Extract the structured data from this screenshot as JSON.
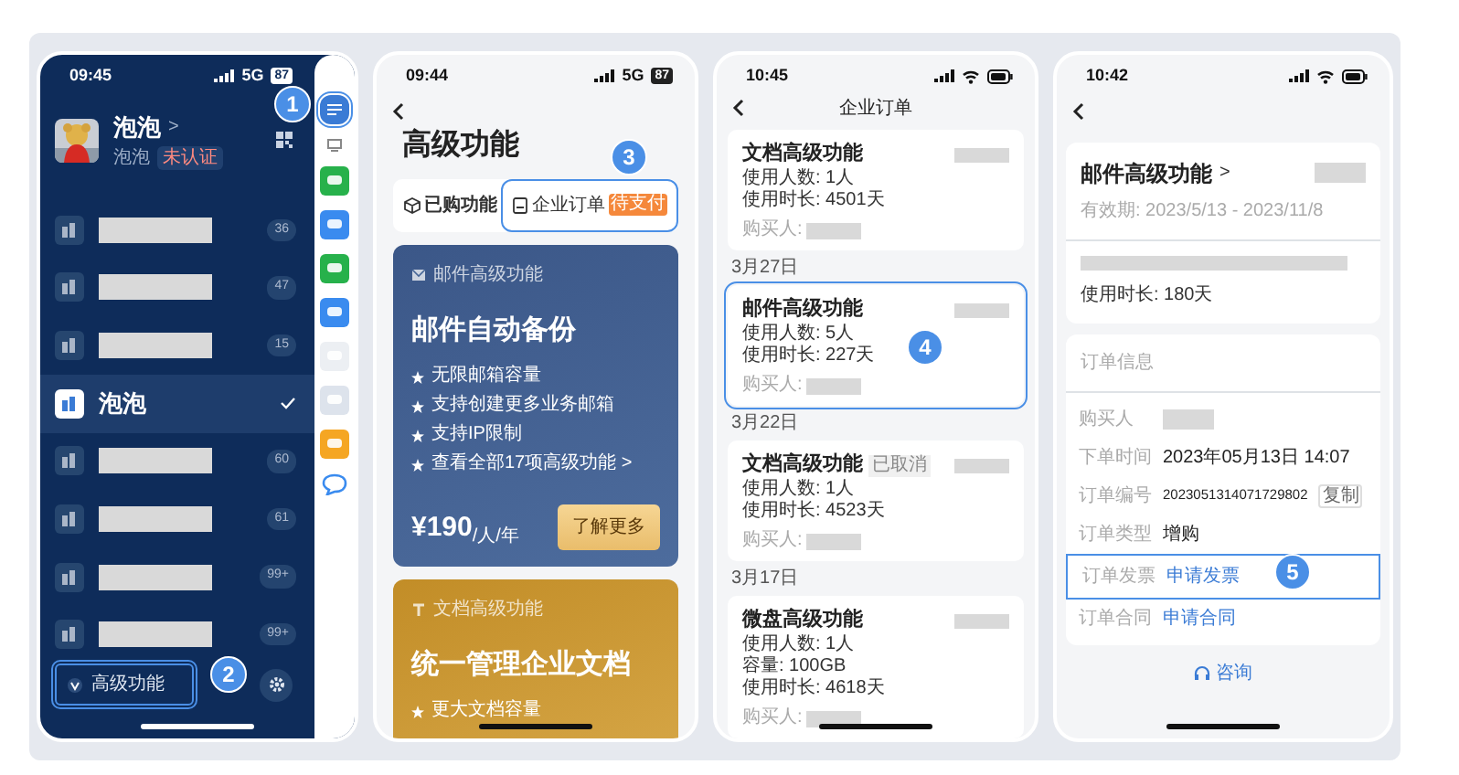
{
  "phones": [
    {
      "kind": "sidebar",
      "status": {
        "time": "09:45",
        "network": "5G",
        "battery": "87"
      },
      "profile": {
        "name": "泡泡",
        "chevron": ">",
        "subtitle": "泡泡",
        "badge": "未认证"
      },
      "menu_button": {
        "callout": "1"
      },
      "teams": [
        {
          "count": "36",
          "selected": false
        },
        {
          "count": "47",
          "selected": false
        },
        {
          "count": "15",
          "selected": false
        },
        {
          "name": "泡泡",
          "selected": true
        },
        {
          "count": "60",
          "selected": false
        },
        {
          "count": "61",
          "selected": false
        },
        {
          "count": "99+",
          "selected": false
        },
        {
          "count": "99+",
          "selected": false
        }
      ],
      "footer_button": {
        "label": "高级功能",
        "callout": "2"
      }
    },
    {
      "kind": "features",
      "status": {
        "time": "09:44",
        "network": "5G",
        "battery": "87"
      },
      "title": "高级功能",
      "tabs": [
        {
          "label": "已购功能",
          "selected": true
        },
        {
          "label": "企业订单",
          "badge": "待支付",
          "selected": false,
          "callout": "3"
        }
      ],
      "cards": [
        {
          "kind": "mail",
          "category": "邮件高级功能",
          "title": "邮件自动备份",
          "features": [
            "无限邮箱容量",
            "支持创建更多业务邮箱",
            "支持IP限制",
            "查看全部17项高级功能 >"
          ],
          "price": "¥190",
          "unit": "/人/年",
          "button": "了解更多"
        },
        {
          "kind": "docs",
          "category": "文档高级功能",
          "title": "统一管理企业文档",
          "features": [
            "更大文档容量"
          ]
        }
      ]
    },
    {
      "kind": "orders",
      "status": {
        "time": "10:45"
      },
      "title": "企业订单",
      "orders": [
        {
          "title": "文档高级功能",
          "lines": [
            "使用人数: 1人",
            "使用时长: 4501天"
          ],
          "buyer": "购买人:"
        },
        {
          "date": "3月27日",
          "title": "邮件高级功能",
          "lines": [
            "使用人数: 5人",
            "使用时长: 227天"
          ],
          "buyer": "购买人:",
          "callout": "4"
        },
        {
          "date": "3月22日",
          "title": "文档高级功能",
          "tag": "已取消",
          "lines": [
            "使用人数: 1人",
            "使用时长: 4523天"
          ],
          "buyer": "购买人:"
        },
        {
          "date": "3月17日",
          "title": "微盘高级功能",
          "lines": [
            "使用人数: 1人",
            "容量: 100GB",
            "使用时长: 4618天"
          ],
          "buyer": "购买人:"
        }
      ]
    },
    {
      "kind": "detail",
      "status": {
        "time": "10:42"
      },
      "product": {
        "title": "邮件高级功能",
        "chevron": ">",
        "validity": "有效期: 2023/5/13 - 2023/11/8",
        "duration": "使用时长: 180天"
      },
      "info": {
        "heading": "订单信息",
        "rows": [
          {
            "kind": "redacted",
            "label": "购买人"
          },
          {
            "kind": "text",
            "label": "下单时间",
            "value": "2023年05月13日 14:07"
          },
          {
            "kind": "copy",
            "label": "订单编号",
            "value": "2023051314071729802",
            "action": "复制"
          },
          {
            "kind": "text",
            "label": "订单类型",
            "value": "增购"
          },
          {
            "kind": "link",
            "label": "订单发票",
            "value": "申请发票",
            "callout": "5"
          },
          {
            "kind": "link",
            "label": "订单合同",
            "value": "申请合同"
          }
        ]
      },
      "consult": "咨询"
    }
  ]
}
